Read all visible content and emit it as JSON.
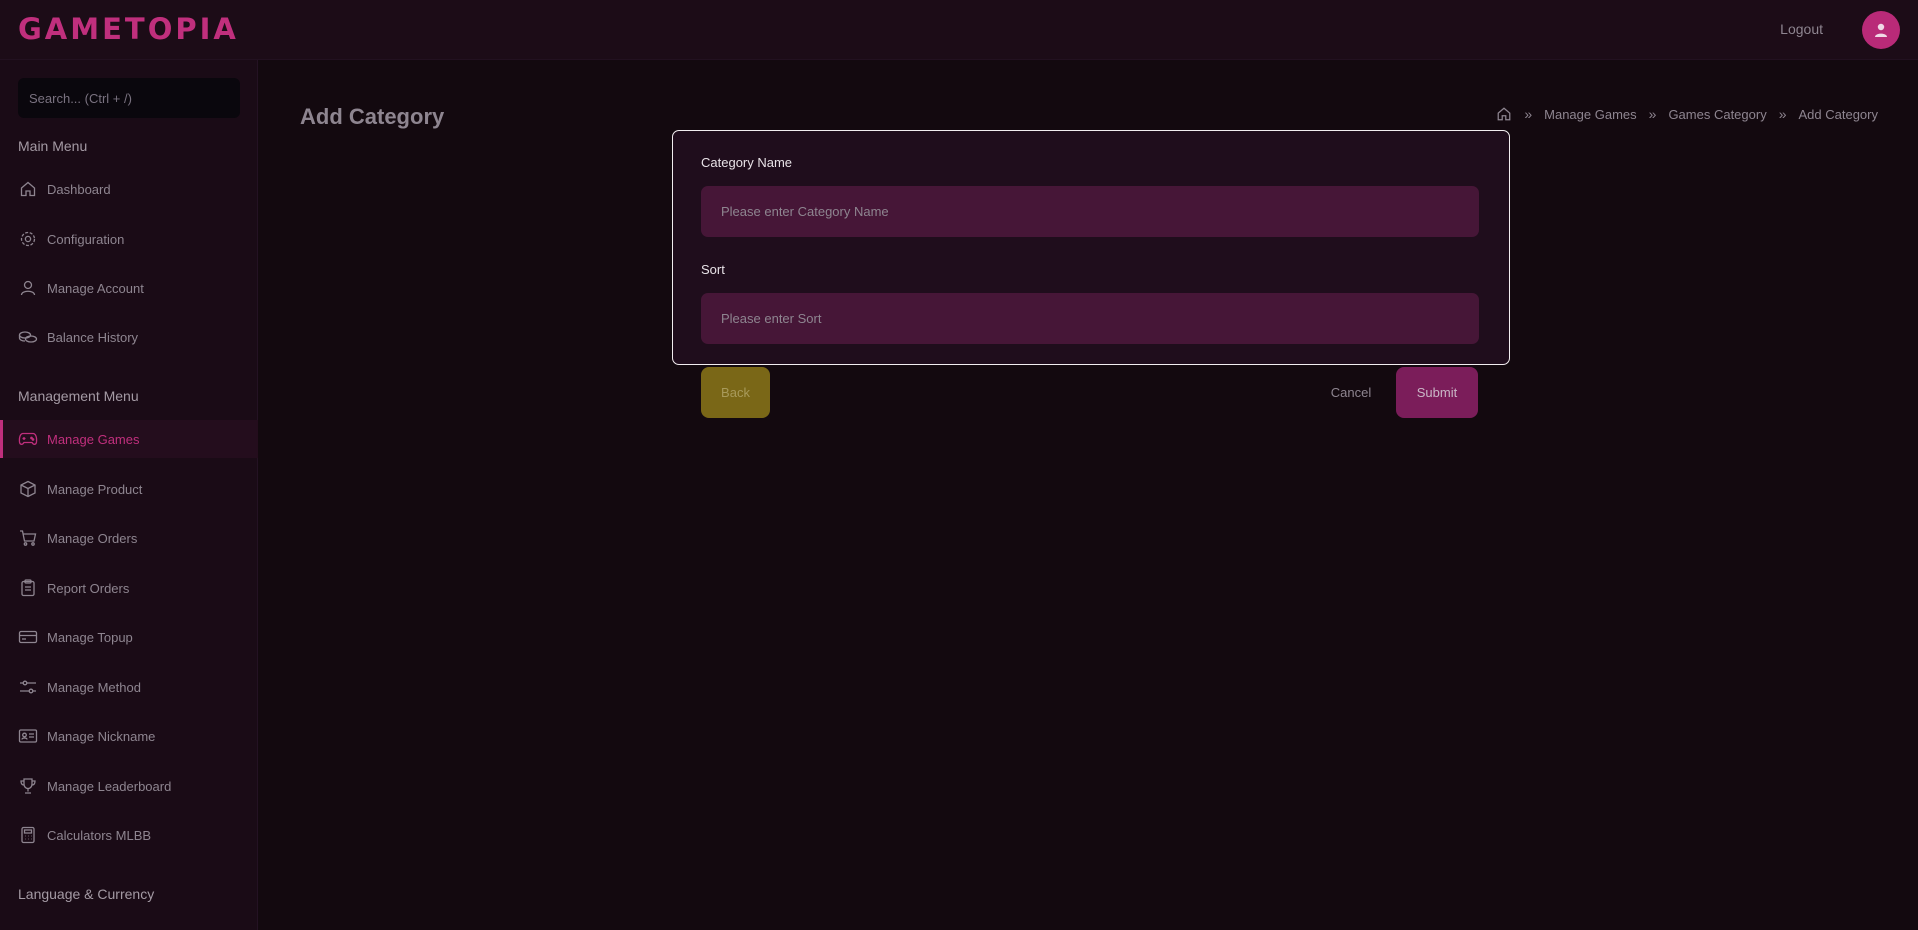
{
  "app": {
    "logo": "GAMETOPIA",
    "logout_label": "Logout"
  },
  "search": {
    "placeholder": "Search... (Ctrl + /)"
  },
  "sidebar": {
    "main_menu_title": "Main Menu",
    "main_items": [
      {
        "label": "Dashboard",
        "icon": "home-icon"
      },
      {
        "label": "Configuration",
        "icon": "gear-icon"
      },
      {
        "label": "Manage Account",
        "icon": "user-icon"
      },
      {
        "label": "Balance History",
        "icon": "coins-icon"
      }
    ],
    "management_menu_title": "Management Menu",
    "management_items": [
      {
        "label": "Manage Games",
        "icon": "gamepad-icon",
        "active": true
      },
      {
        "label": "Manage Product",
        "icon": "box-icon"
      },
      {
        "label": "Manage Orders",
        "icon": "cart-icon"
      },
      {
        "label": "Report Orders",
        "icon": "clipboard-icon"
      },
      {
        "label": "Manage Topup",
        "icon": "wallet-icon"
      },
      {
        "label": "Manage Method",
        "icon": "sliders-icon"
      },
      {
        "label": "Manage Nickname",
        "icon": "id-card-icon"
      },
      {
        "label": "Manage Leaderboard",
        "icon": "trophy-icon"
      },
      {
        "label": "Calculators MLBB",
        "icon": "calculator-icon"
      }
    ],
    "language_title": "Language & Currency"
  },
  "page": {
    "title": "Add Category",
    "breadcrumb": [
      "Manage Games",
      "Games Category",
      "Add Category"
    ]
  },
  "form": {
    "category_name_label": "Category Name",
    "category_name_placeholder": "Please enter Category Name",
    "category_name_value": "",
    "sort_label": "Sort",
    "sort_placeholder": "Please enter Sort",
    "sort_value": ""
  },
  "actions": {
    "back": "Back",
    "cancel": "Cancel",
    "submit": "Submit"
  },
  "colors": {
    "accent": "#c02f7d",
    "background": "#13090f",
    "input_bg": "#461637",
    "back_button": "#7a6717",
    "submit_button": "#7b1d5a"
  }
}
